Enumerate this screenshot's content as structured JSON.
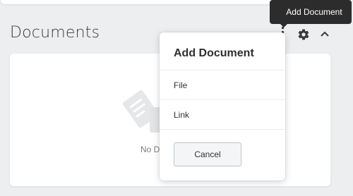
{
  "section": {
    "title": "Documents"
  },
  "empty_state": {
    "text": "No Documents"
  },
  "tooltip": {
    "text": "Add Document"
  },
  "popover": {
    "title": "Add Document",
    "items": [
      {
        "label": "File"
      },
      {
        "label": "Link"
      }
    ],
    "cancel_label": "Cancel"
  },
  "toolbar": {
    "icons": [
      "add-document-icon",
      "gear-icon",
      "chevron-up-icon"
    ]
  },
  "colors": {
    "tooltip_bg": "#2c2c2c",
    "icon": "#3a3a3a"
  }
}
